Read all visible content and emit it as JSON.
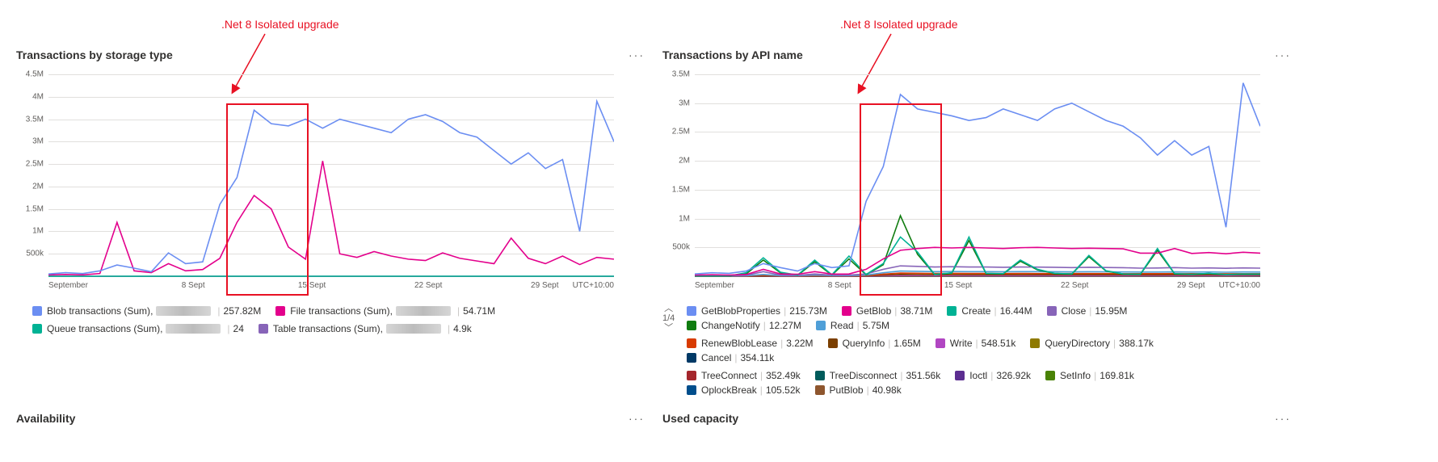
{
  "annotation": ".Net 8 Isolated upgrade",
  "timezone": "UTC+10:00",
  "palette": {
    "blob": "#6b8ef2",
    "file": "#e3008c",
    "queue": "#00b294",
    "table": "#8764b8",
    "getblobprop": "#6b8ef2",
    "getblob": "#e3008c",
    "create": "#00b294",
    "close": "#8764b8",
    "changenotify": "#107c10",
    "read": "#4f9fd8",
    "renewbloblease": "#d83b01",
    "queryinfo": "#7b3f00",
    "write": "#b146c2",
    "querydirectory": "#8f7a00",
    "cancel": "#003966",
    "treeconnect": "#a4262c",
    "treedisconnect": "#005b5b",
    "ioctl": "#5c2e91",
    "setinfo": "#498205",
    "oplockbreak": "#004e8c",
    "putblob": "#8e562e"
  },
  "tiles_bottom": {
    "left": "Availability",
    "right": "Used capacity"
  },
  "pager": "1/4",
  "chart_data": [
    {
      "id": "storage",
      "title": "Transactions by storage type",
      "type": "line",
      "ylim": [
        0,
        4500000
      ],
      "yticks": [
        0,
        500000,
        1000000,
        1500000,
        2000000,
        2500000,
        3000000,
        3500000,
        4000000,
        4500000
      ],
      "ytick_labels": [
        "",
        "500k",
        "1M",
        "1.5M",
        "2M",
        "2.5M",
        "3M",
        "3.5M",
        "4M",
        "4.5M"
      ],
      "xticks": [
        0,
        8,
        15,
        22,
        29
      ],
      "xtick_labels": [
        "September",
        "8 Sept",
        "15 Sept",
        "22 Sept",
        "29 Sept"
      ],
      "xrange": [
        0,
        34
      ],
      "series": [
        {
          "name": "Blob transactions (Sum)",
          "color": "blob",
          "total": "257.82M",
          "redacted_middle": true,
          "values": [
            50,
            80,
            60,
            120,
            250,
            180,
            100,
            520,
            280,
            320,
            1600,
            2200,
            3700,
            3400,
            3350,
            3500,
            3300,
            3500,
            3400,
            3300,
            3200,
            3500,
            3600,
            3450,
            3200,
            3100,
            2800,
            2500,
            2750,
            2400,
            2600,
            1000,
            3900,
            3000
          ]
        },
        {
          "name": "File transactions (Sum)",
          "color": "file",
          "total": "54.71M",
          "redacted_middle": true,
          "values": [
            30,
            40,
            30,
            60,
            1200,
            120,
            80,
            280,
            120,
            150,
            400,
            1200,
            1800,
            1500,
            650,
            380,
            2570,
            500,
            420,
            550,
            450,
            380,
            350,
            520,
            400,
            340,
            280,
            850,
            400,
            280,
            450,
            260,
            420,
            380
          ]
        },
        {
          "name": "Queue transactions (Sum)",
          "color": "queue",
          "total": "24",
          "redacted_middle": true,
          "values": [
            0,
            0,
            0,
            0,
            0,
            0,
            0,
            0,
            0,
            0,
            0,
            0,
            0,
            0,
            0,
            0,
            0,
            0,
            0,
            0,
            0,
            0,
            0,
            0,
            0,
            0,
            0,
            0,
            0,
            0,
            0,
            0,
            0,
            0
          ]
        },
        {
          "name": "Table transactions (Sum)",
          "color": "table",
          "total": "4.9k",
          "redacted_middle": true,
          "values": [
            0,
            0,
            0,
            0,
            0,
            0,
            0,
            0,
            0,
            0,
            0,
            0,
            0,
            0,
            0,
            0,
            0,
            0,
            0,
            0,
            0,
            0,
            0,
            0,
            0,
            0,
            0,
            0,
            0,
            0,
            0,
            0,
            0,
            0
          ]
        }
      ]
    },
    {
      "id": "api",
      "title": "Transactions by API name",
      "type": "line",
      "ylim": [
        0,
        3500000
      ],
      "yticks": [
        0,
        500000,
        1000000,
        1500000,
        2000000,
        2500000,
        3000000,
        3500000
      ],
      "ytick_labels": [
        "",
        "500k",
        "1M",
        "1.5M",
        "2M",
        "2.5M",
        "3M",
        "3.5M"
      ],
      "xticks": [
        0,
        8,
        15,
        22,
        29
      ],
      "xtick_labels": [
        "September",
        "8 Sept",
        "15 Sept",
        "22 Sept",
        "29 Sept"
      ],
      "xrange": [
        0,
        34
      ],
      "series": [
        {
          "name": "GetBlobProperties",
          "color": "getblobprop",
          "total": "215.73M",
          "values": [
            40,
            60,
            50,
            90,
            220,
            150,
            90,
            220,
            150,
            180,
            1300,
            1900,
            3150,
            2900,
            2840,
            2780,
            2700,
            2750,
            2900,
            2800,
            2700,
            2900,
            3000,
            2850,
            2700,
            2600,
            2400,
            2100,
            2350,
            2100,
            2250,
            850,
            3350,
            2600
          ]
        },
        {
          "name": "GetBlob",
          "color": "getblob",
          "total": "38.71M",
          "values": [
            20,
            25,
            20,
            30,
            120,
            40,
            35,
            80,
            38,
            40,
            120,
            300,
            450,
            480,
            500,
            490,
            500,
            490,
            480,
            495,
            500,
            490,
            480,
            485,
            480,
            475,
            400,
            400,
            480,
            395,
            410,
            390,
            415,
            400
          ]
        },
        {
          "name": "Create",
          "color": "create",
          "total": "16.44M",
          "values": [
            5,
            5,
            5,
            60,
            320,
            70,
            20,
            280,
            25,
            350,
            30,
            220,
            680,
            420,
            30,
            60,
            680,
            50,
            45,
            280,
            120,
            50,
            40,
            360,
            95,
            40,
            35,
            480,
            45,
            35,
            50,
            30,
            40,
            38
          ]
        },
        {
          "name": "Close",
          "color": "close",
          "total": "15.95M",
          "values": [
            10,
            12,
            10,
            18,
            80,
            20,
            15,
            40,
            18,
            20,
            40,
            120,
            180,
            170,
            160,
            165,
            160,
            160,
            155,
            160,
            158,
            155,
            150,
            155,
            152,
            148,
            140,
            142,
            150,
            140,
            144,
            138,
            145,
            140
          ]
        },
        {
          "name": "ChangeNotify",
          "color": "changenotify",
          "total": "12.27M",
          "values": [
            5,
            5,
            5,
            40,
            280,
            60,
            15,
            250,
            20,
            300,
            25,
            200,
            1050,
            380,
            28,
            55,
            620,
            48,
            42,
            260,
            110,
            48,
            38,
            340,
            90,
            38,
            32,
            450,
            42,
            32,
            48,
            28,
            38,
            36
          ]
        },
        {
          "name": "Read",
          "color": "read",
          "total": "5.75M",
          "values": [
            5,
            5,
            5,
            8,
            30,
            10,
            8,
            20,
            10,
            10,
            20,
            60,
            90,
            85,
            80,
            82,
            80,
            80,
            78,
            80,
            79,
            78,
            76,
            78,
            77,
            75,
            72,
            73,
            76,
            72,
            74,
            70,
            74,
            72
          ]
        },
        {
          "name": "RenewBlobLease",
          "color": "renewbloblease",
          "total": "3.22M",
          "values": [
            3,
            3,
            3,
            5,
            18,
            6,
            5,
            12,
            6,
            6,
            12,
            36,
            55,
            52,
            48,
            50,
            48,
            48,
            47,
            48,
            47,
            47,
            46,
            47,
            46,
            45,
            44,
            44,
            46,
            44,
            45,
            43,
            45,
            44
          ]
        },
        {
          "name": "QueryInfo",
          "color": "queryinfo",
          "total": "1.65M",
          "values": [
            2,
            2,
            2,
            3,
            10,
            4,
            3,
            7,
            4,
            4,
            7,
            20,
            30,
            28,
            26,
            27,
            26,
            26,
            26,
            26,
            26,
            26,
            25,
            26,
            26,
            25,
            24,
            24,
            25,
            24,
            25,
            24,
            25,
            24
          ]
        },
        {
          "name": "Write",
          "color": "write",
          "total": "548.51k",
          "values": [
            1,
            1,
            1,
            1,
            4,
            1,
            1,
            3,
            1,
            1,
            3,
            8,
            12,
            11,
            10,
            11,
            10,
            10,
            10,
            10,
            10,
            10,
            10,
            10,
            10,
            10,
            10,
            10,
            10,
            10,
            10,
            9,
            10,
            10
          ]
        },
        {
          "name": "QueryDirectory",
          "color": "querydirectory",
          "total": "388.17k",
          "values": [
            1,
            1,
            1,
            1,
            3,
            1,
            1,
            2,
            1,
            1,
            2,
            5,
            8,
            8,
            7,
            7,
            7,
            7,
            7,
            7,
            7,
            7,
            7,
            7,
            7,
            7,
            7,
            7,
            7,
            7,
            7,
            6,
            7,
            7
          ]
        },
        {
          "name": "Cancel",
          "color": "cancel",
          "total": "354.11k",
          "values": [
            1,
            1,
            1,
            1,
            3,
            1,
            1,
            2,
            1,
            1,
            2,
            5,
            8,
            7,
            7,
            7,
            7,
            7,
            7,
            7,
            7,
            7,
            7,
            7,
            7,
            6,
            6,
            6,
            7,
            6,
            7,
            6,
            7,
            6
          ]
        },
        {
          "name": "TreeConnect",
          "color": "treeconnect",
          "total": "352.49k",
          "values": [
            1,
            1,
            1,
            1,
            3,
            1,
            1,
            2,
            1,
            1,
            2,
            5,
            8,
            7,
            7,
            7,
            7,
            7,
            7,
            7,
            7,
            7,
            7,
            7,
            7,
            6,
            6,
            6,
            7,
            6,
            7,
            6,
            7,
            6
          ]
        },
        {
          "name": "TreeDisconnect",
          "color": "treedisconnect",
          "total": "351.56k",
          "values": [
            1,
            1,
            1,
            1,
            3,
            1,
            1,
            2,
            1,
            1,
            2,
            5,
            8,
            7,
            7,
            7,
            7,
            7,
            7,
            7,
            7,
            7,
            7,
            7,
            7,
            6,
            6,
            6,
            7,
            6,
            7,
            6,
            7,
            6
          ]
        },
        {
          "name": "Ioctl",
          "color": "ioctl",
          "total": "326.92k",
          "values": [
            1,
            1,
            1,
            1,
            2,
            1,
            1,
            2,
            1,
            1,
            2,
            4,
            7,
            7,
            6,
            6,
            6,
            6,
            6,
            6,
            6,
            6,
            6,
            6,
            6,
            6,
            6,
            6,
            6,
            6,
            6,
            5,
            6,
            6
          ]
        },
        {
          "name": "SetInfo",
          "color": "setinfo",
          "total": "169.81k",
          "values": [
            0,
            0,
            0,
            0,
            1,
            0,
            0,
            1,
            0,
            0,
            1,
            2,
            4,
            3,
            3,
            3,
            3,
            3,
            3,
            3,
            3,
            3,
            3,
            3,
            3,
            3,
            3,
            3,
            3,
            3,
            3,
            3,
            3,
            3
          ]
        },
        {
          "name": "OplockBreak",
          "color": "oplockbreak",
          "total": "105.52k",
          "values": [
            0,
            0,
            0,
            0,
            1,
            0,
            0,
            1,
            0,
            0,
            1,
            1,
            2,
            2,
            2,
            2,
            2,
            2,
            2,
            2,
            2,
            2,
            2,
            2,
            2,
            2,
            2,
            2,
            2,
            2,
            2,
            2,
            2,
            2
          ]
        },
        {
          "name": "PutBlob",
          "color": "putblob",
          "total": "40.98k",
          "values": [
            0,
            0,
            0,
            0,
            0,
            0,
            0,
            0,
            0,
            0,
            0,
            1,
            1,
            1,
            1,
            1,
            1,
            1,
            1,
            1,
            1,
            1,
            1,
            1,
            1,
            1,
            1,
            1,
            1,
            1,
            1,
            1,
            1,
            1
          ]
        }
      ]
    }
  ]
}
